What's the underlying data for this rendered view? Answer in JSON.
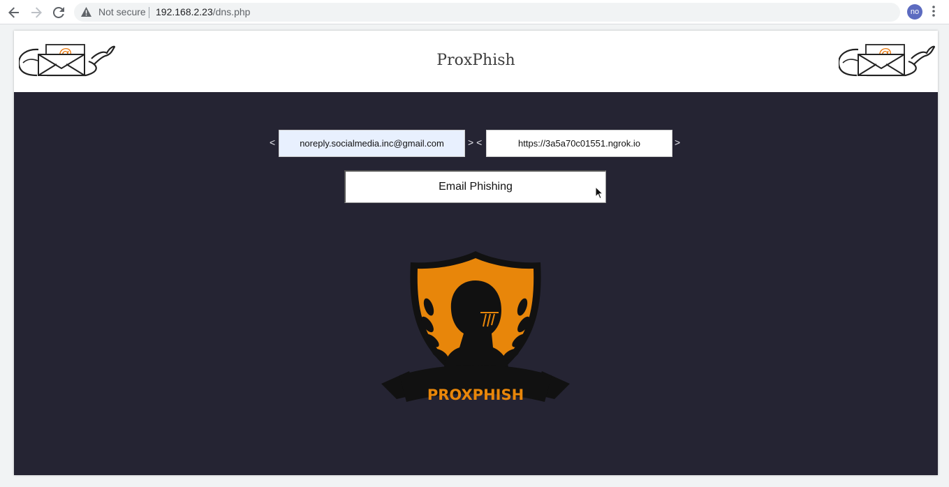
{
  "browser": {
    "security_label": "Not secure",
    "url_host": "192.168.2.23",
    "url_path": "/dns.php",
    "profile_initials": "no"
  },
  "site": {
    "title": "ProxPhish"
  },
  "form": {
    "left_open": "<",
    "middle": "> <",
    "right_close": ">",
    "sender_email_value": "noreply.socialmedia.inc@gmail.com",
    "link_url_value": "https://3a5a70c01551.ngrok.io",
    "submit_label": "Email Phishing"
  },
  "emblem": {
    "text": "PROXPHISH"
  },
  "colors": {
    "page_bg": "#252433",
    "accent_orange": "#e8860a",
    "autofill_bg": "#e8f0fe"
  }
}
